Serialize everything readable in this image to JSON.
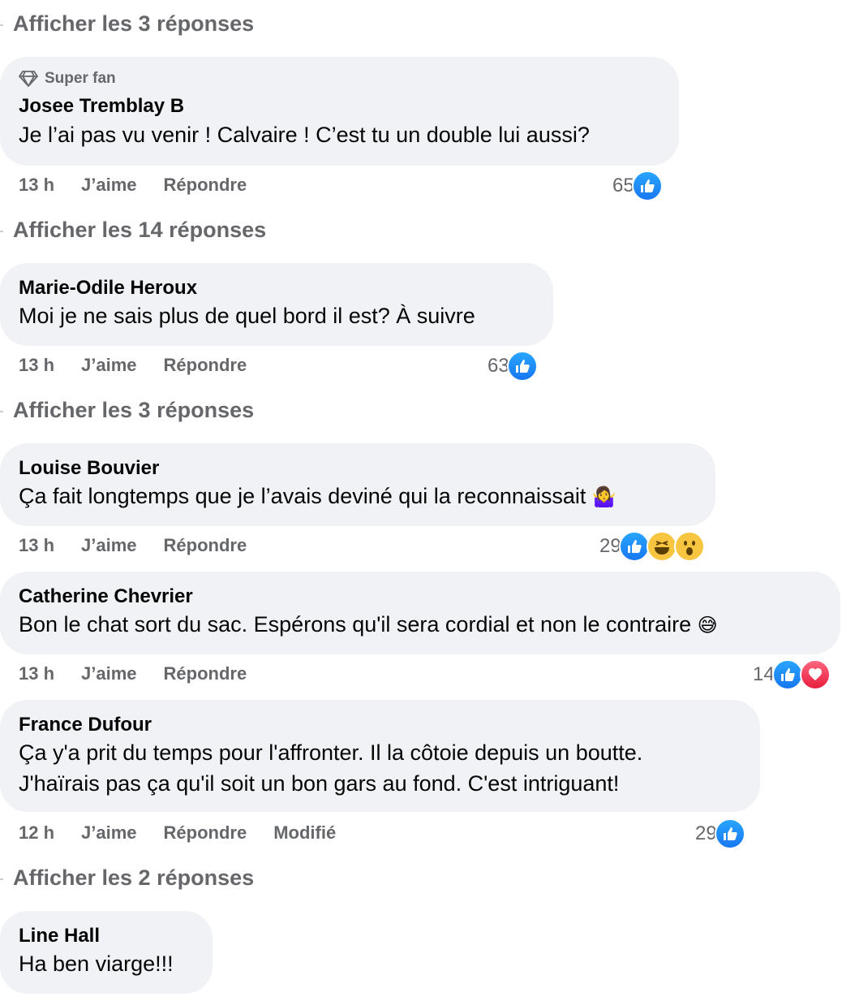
{
  "colors": {
    "like": "#1877f2",
    "love": "#e61e3c",
    "bubble": "#f0f2f5",
    "meta": "#65676b"
  },
  "threads": [
    {
      "view_replies": "Afficher les 3 réponses"
    },
    {
      "badge": "Super fan",
      "author": "Josee Tremblay B",
      "lines": [
        "Je l’ai pas vu venir ! Calvaire ! C’est tu un double lui aussi?"
      ],
      "time": "13 h",
      "like_label": "J’aime",
      "reply_label": "Répondre",
      "reaction_count": "65",
      "reactions": [
        "like-icon"
      ]
    },
    {
      "view_replies": "Afficher les 14 réponses"
    },
    {
      "author": "Marie-Odile Heroux",
      "lines": [
        "Moi je ne sais plus de quel bord il est? À suivre"
      ],
      "time": "13 h",
      "like_label": "J’aime",
      "reply_label": "Répondre",
      "reaction_count": "63",
      "reactions": [
        "like-icon"
      ]
    },
    {
      "view_replies": "Afficher les 3 réponses"
    },
    {
      "author": "Louise Bouvier",
      "lines": [
        "Ça fait longtemps que je l’avais deviné qui la reconnaissait"
      ],
      "emoji": "🤷‍♀️",
      "time": "13 h",
      "like_label": "J’aime",
      "reply_label": "Répondre",
      "reaction_count": "29",
      "reactions": [
        "like-icon",
        "haha-icon",
        "wow-icon"
      ]
    },
    {
      "author": "Catherine Chevrier",
      "lines": [
        "Bon le chat sort du sac. Espérons qu'il sera cordial et non le contraire"
      ],
      "emoji": "😅",
      "time": "13 h",
      "like_label": "J’aime",
      "reply_label": "Répondre",
      "reaction_count": "14",
      "reactions": [
        "like-icon",
        "love-icon"
      ]
    },
    {
      "author": "France Dufour",
      "lines": [
        "Ça y'a prit du temps pour l'affronter. Il la côtoie depuis un boutte.",
        "J'haïrais pas ça qu'il soit un bon gars au fond. C'est intriguant!"
      ],
      "time": "12 h",
      "like_label": "J’aime",
      "reply_label": "Répondre",
      "edited_label": "Modifié",
      "reaction_count": "29",
      "reactions": [
        "like-icon"
      ]
    },
    {
      "view_replies": "Afficher les 2 réponses"
    },
    {
      "author": "Line Hall",
      "lines": [
        "Ha ben viarge!!!"
      ]
    }
  ]
}
